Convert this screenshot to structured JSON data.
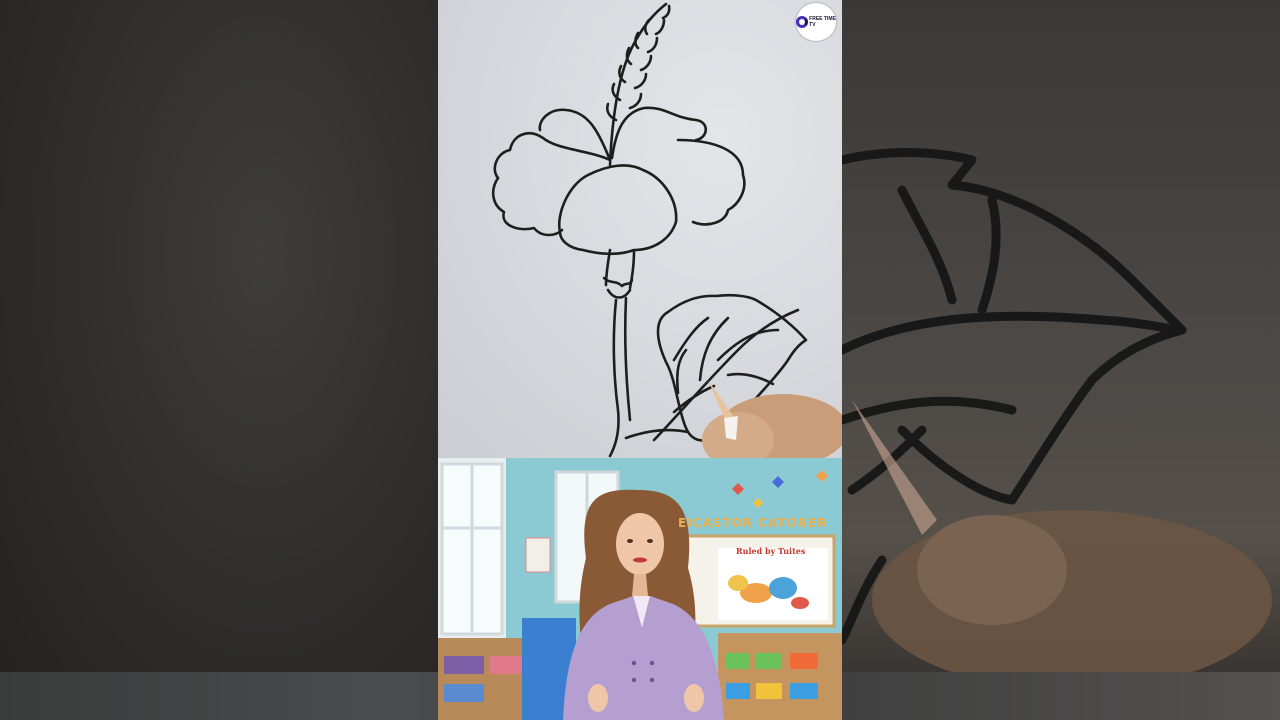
{
  "logo": {
    "name": "free-time-logo",
    "text": "FREE TIME",
    "subtext": "TV"
  },
  "classroom": {
    "board_banner": "EICASTOR CATORER",
    "poster_title": "Ruled by Tuites"
  },
  "colors": {
    "paper": "#d9dadf",
    "pencil_line": "#1e1e1e",
    "wall": "#8ccad3",
    "blazer": "#b49fd0",
    "backdrop": "#2b2a29"
  }
}
